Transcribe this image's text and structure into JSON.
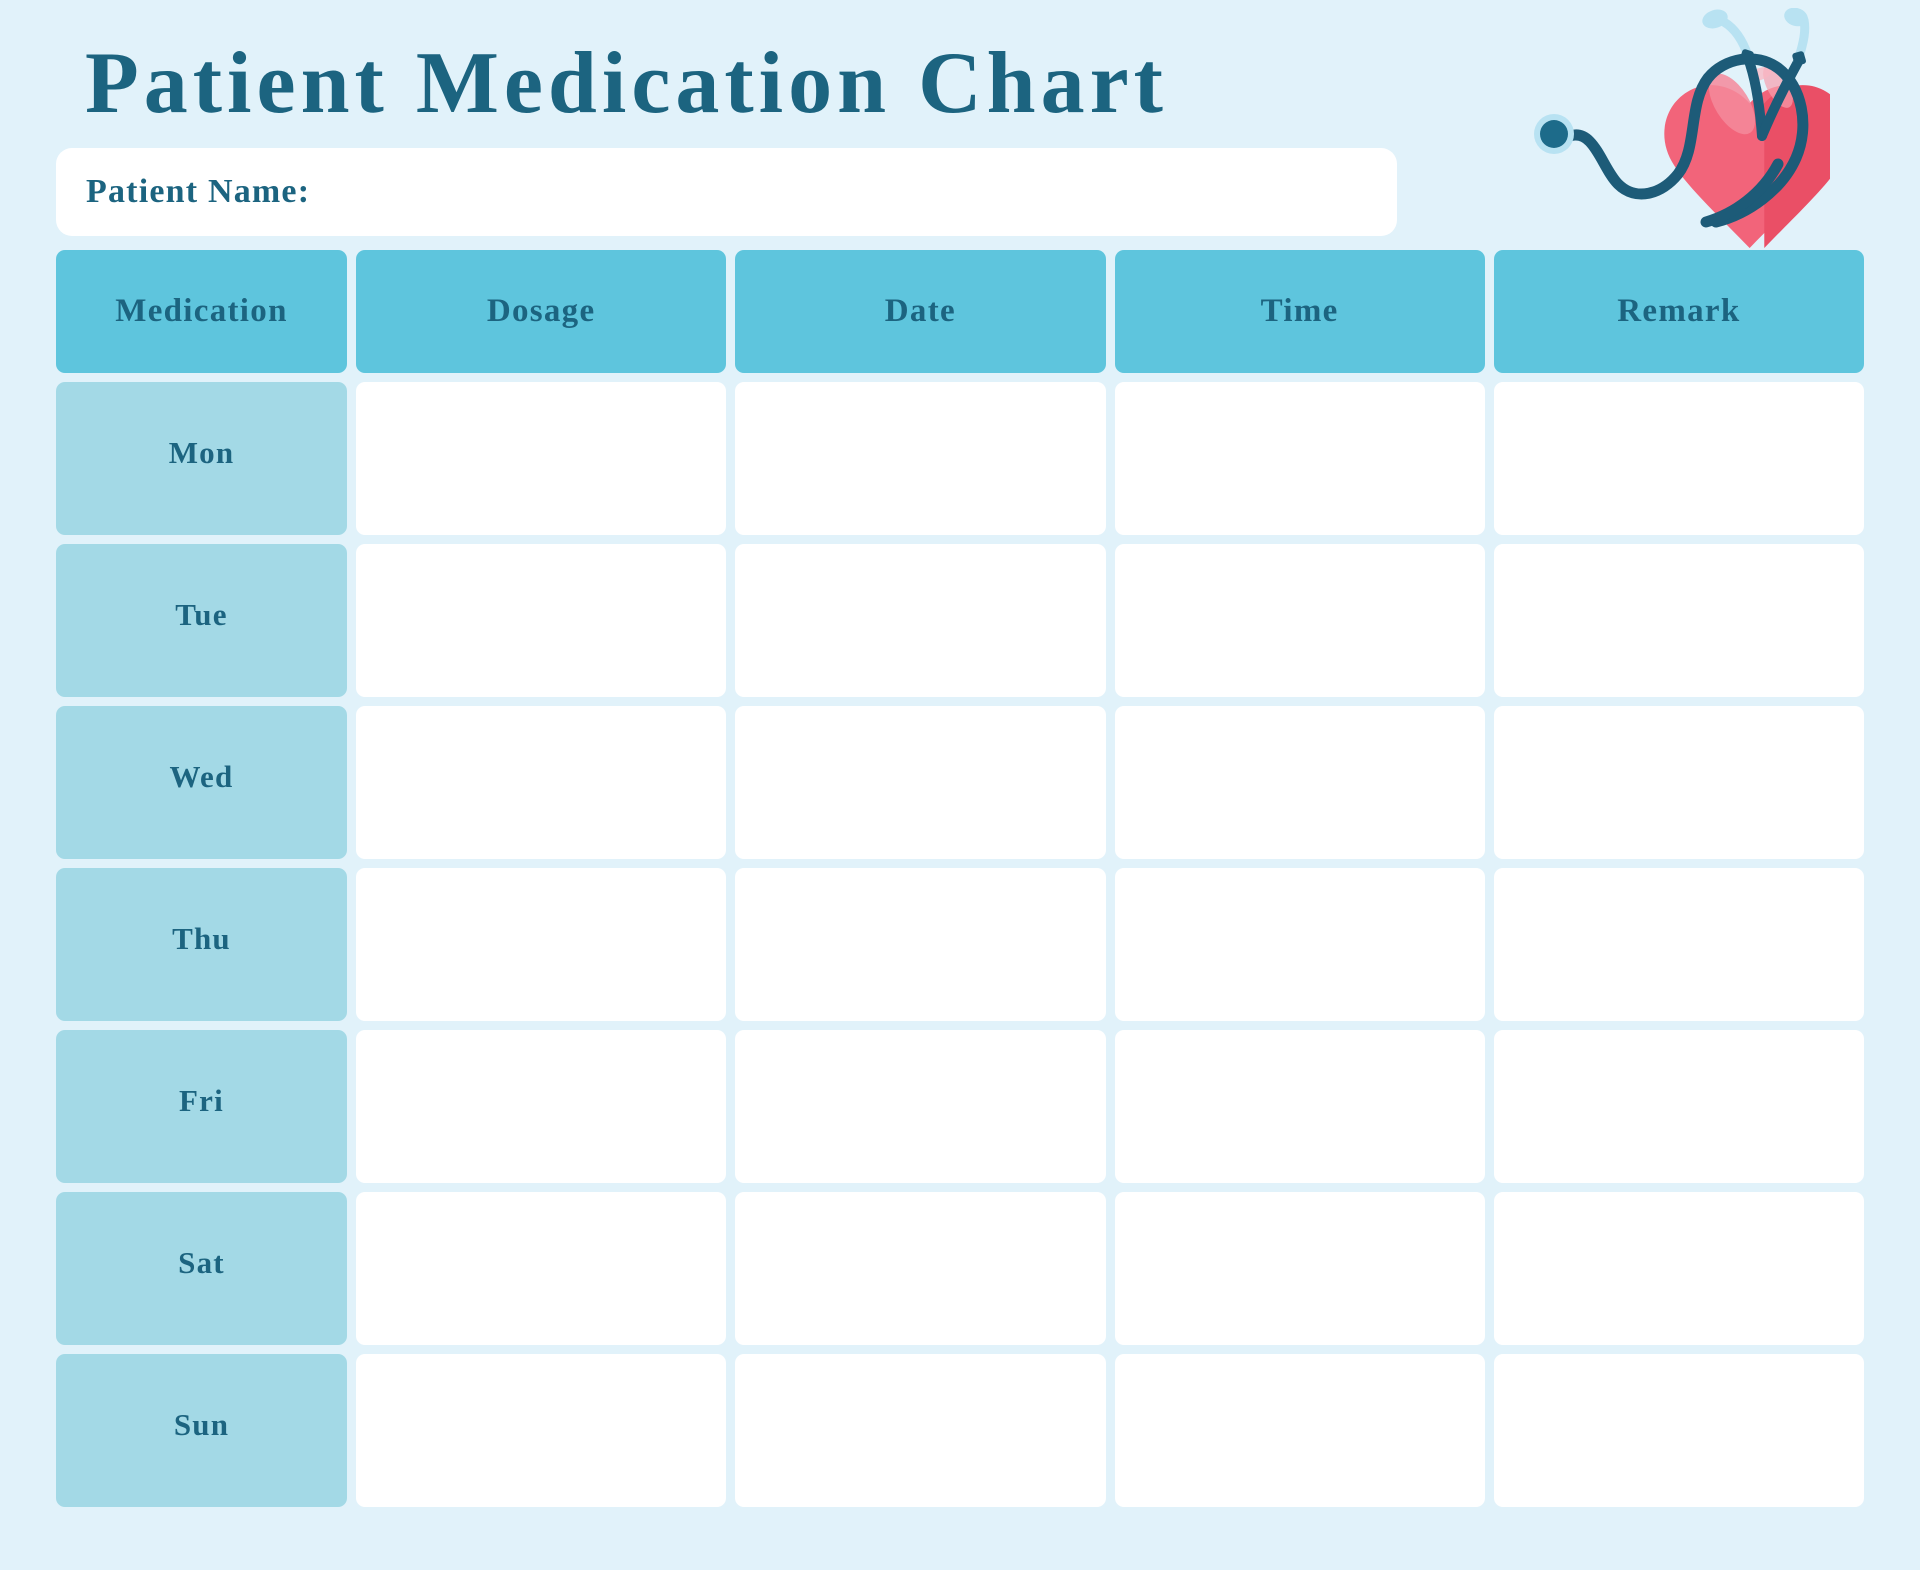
{
  "document": {
    "title": "Patient Medication Chart"
  },
  "patient": {
    "name_label": "Patient Name:",
    "name_value": "",
    "name_placeholder": ""
  },
  "illustration": {
    "name": "heart-with-stethoscope-illustration",
    "heart_color": "#f2647a",
    "heart_shadow_color": "#e8495f",
    "heart_highlight_color": "#f58a9c",
    "tube_color": "#1d5b78",
    "ear_tube_color": "#b8e2f2",
    "chestpiece_color": "#1d6b8a",
    "chestpiece_ring_color": "#b8e2f2"
  },
  "theme": {
    "background": "#e1f2fa",
    "header_cell": "#5ec5dd",
    "day_cell": "#a3d9e6",
    "entry_cell": "#ffffff",
    "text_color": "#1c6480"
  },
  "table": {
    "columns": [
      {
        "key": "medication",
        "label": "Medication"
      },
      {
        "key": "dosage",
        "label": "Dosage"
      },
      {
        "key": "date",
        "label": "Date"
      },
      {
        "key": "time",
        "label": "Time"
      },
      {
        "key": "remark",
        "label": "Remark"
      }
    ],
    "rows": [
      {
        "day": "Mon",
        "dosage": "",
        "date": "",
        "time": "",
        "remark": ""
      },
      {
        "day": "Tue",
        "dosage": "",
        "date": "",
        "time": "",
        "remark": ""
      },
      {
        "day": "Wed",
        "dosage": "",
        "date": "",
        "time": "",
        "remark": ""
      },
      {
        "day": "Thu",
        "dosage": "",
        "date": "",
        "time": "",
        "remark": ""
      },
      {
        "day": "Fri",
        "dosage": "",
        "date": "",
        "time": "",
        "remark": ""
      },
      {
        "day": "Sat",
        "dosage": "",
        "date": "",
        "time": "",
        "remark": ""
      },
      {
        "day": "Sun",
        "dosage": "",
        "date": "",
        "time": "",
        "remark": ""
      }
    ]
  }
}
